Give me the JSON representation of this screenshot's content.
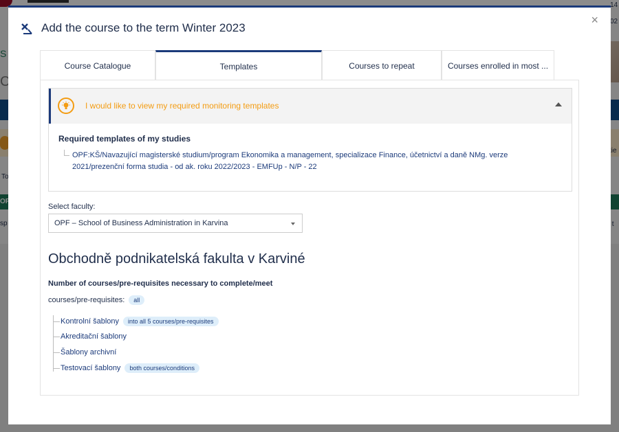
{
  "background": {
    "left_fragments": [
      "S",
      "Co",
      "To",
      "OP",
      "sp"
    ],
    "right_fragments": [
      "14",
      "02",
      "tie",
      "it t"
    ]
  },
  "modal": {
    "title": "Add the course to the term Winter 2023",
    "close_label": "×"
  },
  "tabs": [
    {
      "label": "Course Catalogue",
      "active": false
    },
    {
      "label": "Templates",
      "active": true
    },
    {
      "label": "Courses to repeat",
      "active": false
    },
    {
      "label": "Courses enrolled in most ...",
      "active": false
    }
  ],
  "accordion": {
    "title": "I would like to view my required monitoring templates",
    "required_title": "Required templates of my studies",
    "required_link": "OPF:KŠ/Navazující magisterské studium/program Ekonomika a management, specializace Finance, účetnictví a daně NMg. verze 2021/prezenční forma studia - od ak. roku 2022/2023 - EMFUp - N/P - 22"
  },
  "faculty": {
    "label": "Select faculty:",
    "selected": "OPF – School of Business Administration in Karvina",
    "heading": "Obchodně podnikatelská fakulta v Karviné"
  },
  "requirements": {
    "number_label": "Number of courses/pre-requisites necessary to complete/meet",
    "courses_label": "courses/pre-requisites:",
    "courses_badge": "all",
    "items": [
      {
        "label": "Kontrolní šablony",
        "badge": "into all 5 courses/pre-requisites"
      },
      {
        "label": "Akreditační šablony",
        "badge": ""
      },
      {
        "label": "Šablony archivní",
        "badge": ""
      },
      {
        "label": "Testovací šablony",
        "badge": "both courses/conditions"
      }
    ]
  },
  "colors": {
    "primary": "#1b3a7a",
    "accent_orange": "#f39c12",
    "badge_bg": "#deeefa"
  }
}
